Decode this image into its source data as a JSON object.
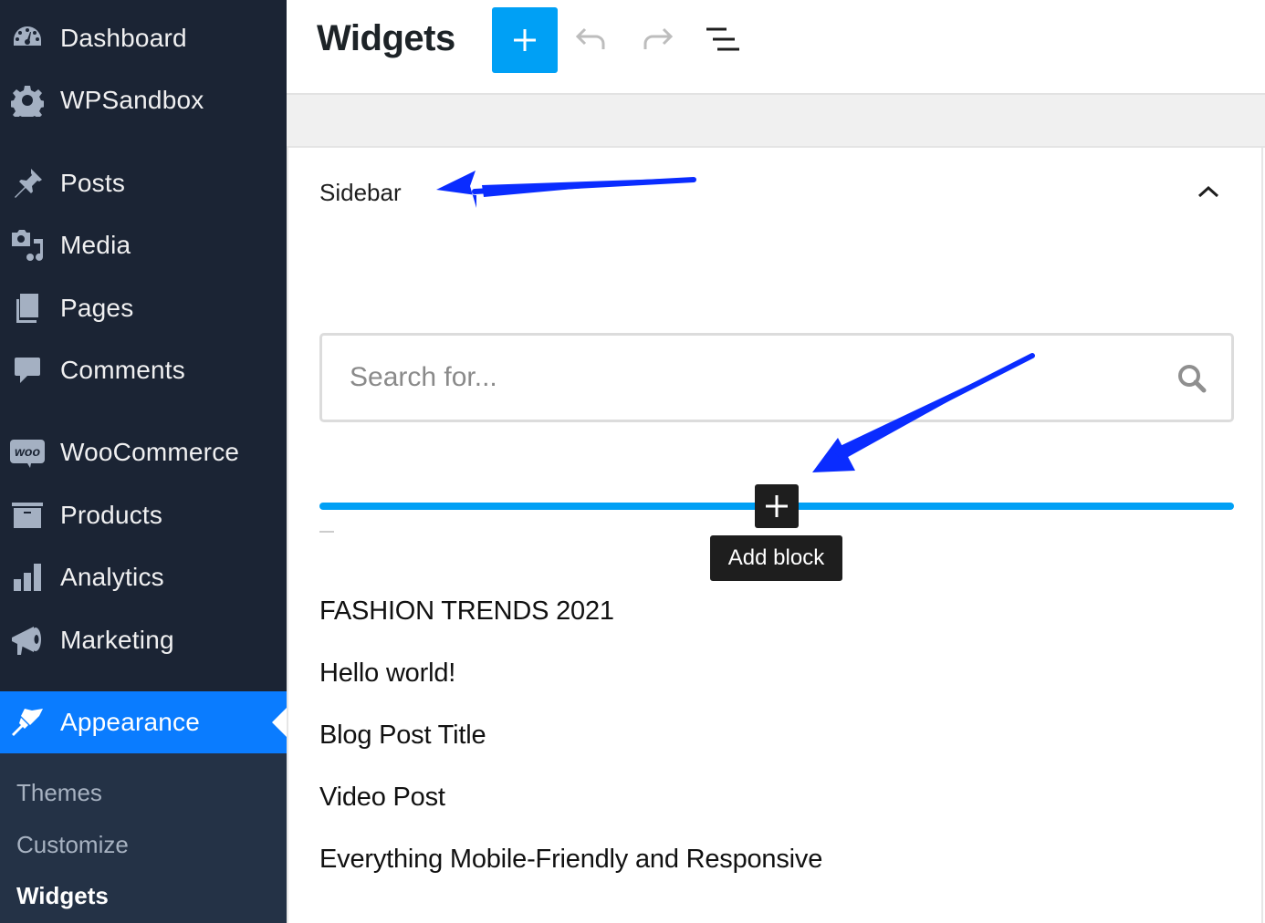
{
  "sidebar": {
    "items": [
      {
        "label": "Dashboard",
        "icon": "dashboard-icon"
      },
      {
        "label": "WPSandbox",
        "icon": "gear-icon"
      },
      {
        "label": "Posts",
        "icon": "pushpin-icon"
      },
      {
        "label": "Media",
        "icon": "media-icon"
      },
      {
        "label": "Pages",
        "icon": "pages-icon"
      },
      {
        "label": "Comments",
        "icon": "comment-icon"
      },
      {
        "label": "WooCommerce",
        "icon": "woo-icon",
        "icon_text": "woo"
      },
      {
        "label": "Products",
        "icon": "archive-icon"
      },
      {
        "label": "Analytics",
        "icon": "bar-chart-icon"
      },
      {
        "label": "Marketing",
        "icon": "megaphone-icon"
      },
      {
        "label": "Appearance",
        "icon": "paintbrush-icon",
        "active": true
      }
    ],
    "submenu": [
      {
        "label": "Themes"
      },
      {
        "label": "Customize"
      },
      {
        "label": "Widgets",
        "current": true
      }
    ],
    "active_color": "#0a7cff",
    "background_color": "#1b2434"
  },
  "header": {
    "title": "Widgets",
    "add_button_label": "+",
    "add_button_color": "#00a0f5",
    "undo_icon": "undo-icon",
    "redo_icon": "redo-icon",
    "list_view_icon": "list-view-icon"
  },
  "widget_area": {
    "title": "Sidebar",
    "collapse_icon": "chevron-up-icon",
    "search": {
      "placeholder": "Search for...",
      "value": ""
    },
    "inserter": {
      "button_label": "+",
      "tooltip": "Add block",
      "line_color": "#00a0f5"
    },
    "posts": [
      "FASHION TRENDS 2021",
      "Hello world!",
      "Blog Post Title",
      "Video Post",
      "Everything Mobile-Friendly and Responsive"
    ]
  },
  "annotations": {
    "arrow_color": "#0a2cff"
  }
}
